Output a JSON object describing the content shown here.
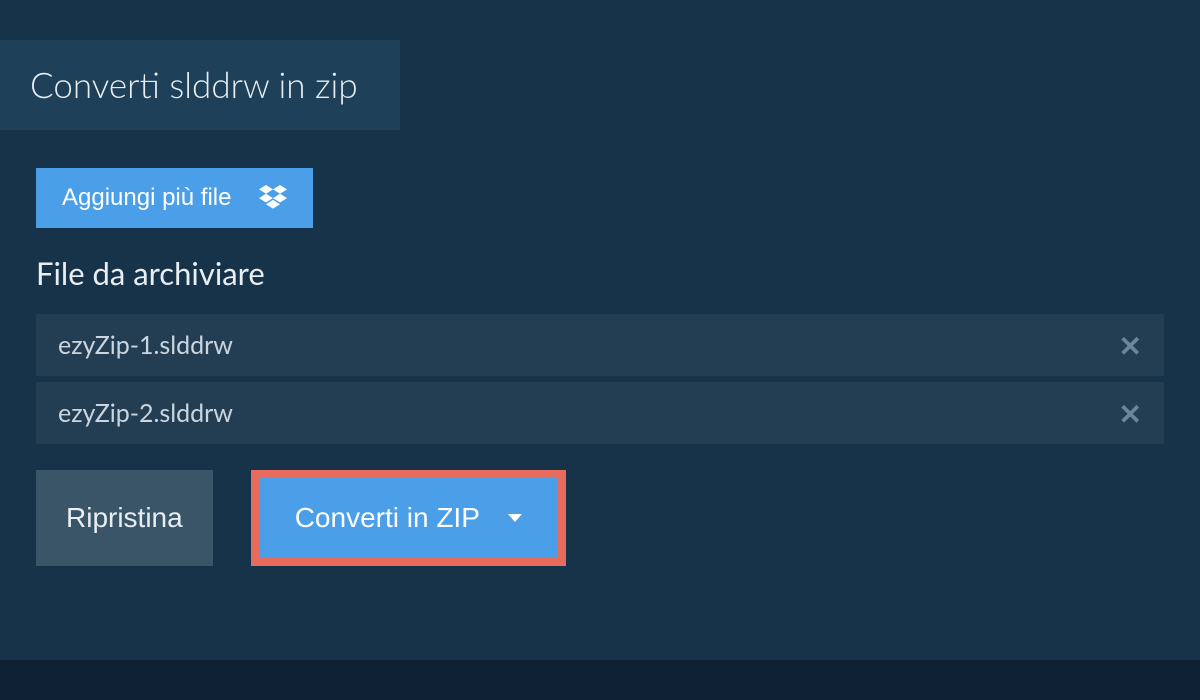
{
  "tab": {
    "title": "Converti slddrw in zip"
  },
  "addFiles": {
    "label": "Aggiungi più file"
  },
  "filesSection": {
    "title": "File da archiviare",
    "files": [
      {
        "name": "ezyZip-1.slddrw"
      },
      {
        "name": "ezyZip-2.slddrw"
      }
    ]
  },
  "actions": {
    "reset": "Ripristina",
    "convert": "Converti in ZIP"
  }
}
